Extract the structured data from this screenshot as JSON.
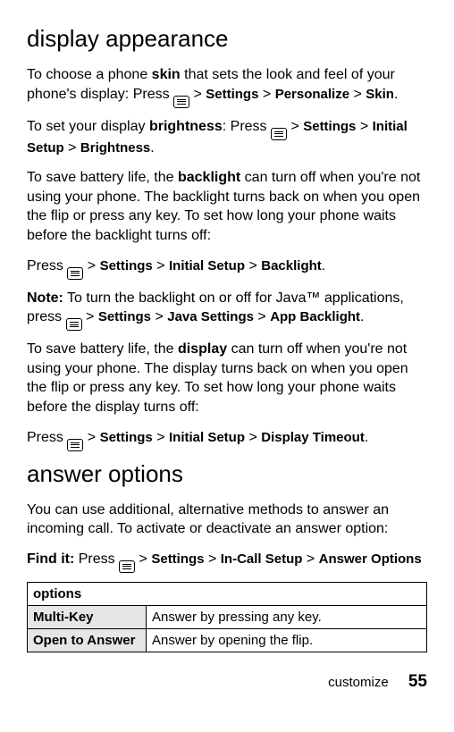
{
  "headings": {
    "display_appearance": "display appearance",
    "answer_options": "answer options"
  },
  "paragraphs": {
    "p1_a": "To choose a phone ",
    "p1_skin": "skin",
    "p1_b": " that sets the look and feel of your phone's display: Press ",
    "p2_a": "To set your display ",
    "p2_brightness": "brightness",
    "p2_b": ": Press ",
    "p3_a": "To save battery life, the ",
    "p3_backlight": "backlight",
    "p3_b": " can turn off when you're not using your phone. The backlight turns back on when you open the flip or press any key. To set how long your phone waits before the backlight turns off:",
    "p4_a": "Press ",
    "p5_note": "Note:",
    "p5_a": " To turn the backlight on or off for Java™ applications, press ",
    "p6_a": "To save battery life, the ",
    "p6_display": "display",
    "p6_b": " can turn off when you're not using your phone. The display turns back on when you open the flip or press any key. To set how long your phone waits before the display turns off:",
    "p7_a": "Press ",
    "p8": "You can use additional, alternative methods to answer an incoming call. To activate or deactivate an answer option:",
    "p9_findit": "Find it:",
    "p9_a": " Press "
  },
  "menu": {
    "settings": "Settings",
    "personalize": "Personalize",
    "skin": "Skin",
    "initial_setup": "Initial Setup",
    "brightness": "Brightness",
    "backlight": "Backlight",
    "java_settings": "Java Settings",
    "app_backlight": "App Backlight",
    "display_timeout": "Display Timeout",
    "incall_setup": "In-Call Setup",
    "answer_options": "Answer Options"
  },
  "sep": {
    "gt": " > ",
    "period": "."
  },
  "table": {
    "header": "options",
    "rows": [
      {
        "name": "Multi-Key",
        "desc": "Answer by pressing any key."
      },
      {
        "name": "Open to Answer",
        "desc": "Answer by opening the flip."
      }
    ]
  },
  "footer": {
    "section": "customize",
    "page": "55"
  }
}
